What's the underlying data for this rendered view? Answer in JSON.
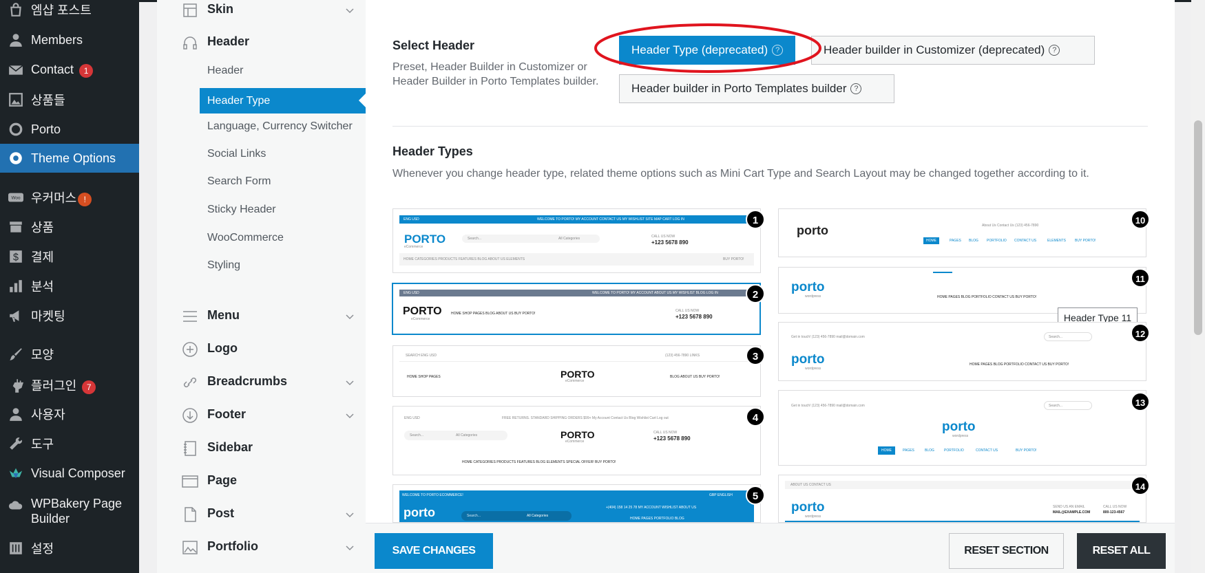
{
  "wp_menu": {
    "items": [
      {
        "label": "엠샵 포스트",
        "icon": "bag-icon",
        "badge": ""
      },
      {
        "label": "Members",
        "icon": "user-icon",
        "badge": ""
      },
      {
        "label": "Contact",
        "icon": "mail-icon",
        "badge": "1"
      },
      {
        "label": "상품들",
        "icon": "image-icon",
        "badge": ""
      },
      {
        "label": "Porto",
        "icon": "circle-icon",
        "badge": ""
      },
      {
        "label": "Theme Options",
        "icon": "gear-icon",
        "badge": ""
      },
      {
        "label": "우커머스",
        "icon": "woo-icon",
        "badge": "!"
      },
      {
        "label": "상품",
        "icon": "archive-icon",
        "badge": ""
      },
      {
        "label": "결제",
        "icon": "dollar-icon",
        "badge": ""
      },
      {
        "label": "분석",
        "icon": "bar-chart-icon",
        "badge": ""
      },
      {
        "label": "마켓팅",
        "icon": "megaphone-icon",
        "badge": ""
      },
      {
        "label": "모양",
        "icon": "brush-icon",
        "badge": ""
      },
      {
        "label": "플러그인",
        "icon": "plugin-icon",
        "badge": "7"
      },
      {
        "label": "사용자",
        "icon": "user-icon",
        "badge": ""
      },
      {
        "label": "도구",
        "icon": "wrench-icon",
        "badge": ""
      },
      {
        "label": "Visual Composer",
        "icon": "vc-icon",
        "badge": ""
      },
      {
        "label": "WPBakery Page Builder",
        "icon": "cloud-icon",
        "badge": ""
      },
      {
        "label": "설정",
        "icon": "sliders-icon",
        "badge": ""
      }
    ]
  },
  "options_nav": {
    "skin": "Skin",
    "header": "Header",
    "header_subs": [
      "Header",
      "Header Type",
      "Language, Currency Switcher",
      "Social Links",
      "Search Form",
      "Sticky Header",
      "WooCommerce",
      "Styling"
    ],
    "menu": "Menu",
    "logo": "Logo",
    "breadcrumbs": "Breadcrumbs",
    "footer": "Footer",
    "sidebar": "Sidebar",
    "page": "Page",
    "post": "Post",
    "portfolio": "Portfolio"
  },
  "select_header": {
    "title": "Select Header",
    "desc": "Preset, Header Builder in Customizer or Header Builder in Porto Templates builder.",
    "options": [
      "Header Type (deprecated)",
      "Header builder in Customizer (deprecated)",
      "Header builder in Porto Templates builder"
    ],
    "help_glyph": "?"
  },
  "header_types": {
    "title": "Header Types",
    "desc": "Whenever you change header type, related theme options such as Mini Cart Type and Search Layout may be changed together according to it.",
    "numbers": [
      "1",
      "2",
      "3",
      "4",
      "5",
      "10",
      "11",
      "12",
      "13",
      "14"
    ],
    "tooltip": "Header Type 11",
    "previews": {
      "t1": {
        "logo": "PORTO",
        "logo_sub": "eCommerce",
        "phone_label": "CALL US NOW",
        "phone": "+123 5678 890",
        "search": "Search...",
        "categories": "All Categories",
        "topbar": "WELCOME TO PORTO!   MY ACCOUNT   CONTACT US   MY WISHLIST   SITE MAP   CART   LOG IN",
        "lang": "ENG   USD",
        "nav": "HOME   CATEGORIES   PRODUCTS   FEATURES   BLOG   ABOUT US   ELEMENTS",
        "buy": "BUY PORTO!"
      },
      "t2": {
        "logo": "PORTO",
        "logo_sub": "eCommerce",
        "nav": "HOME   SHOP   PAGES   BLOG   ABOUT US   BUY PORTO!",
        "phone_label": "CALL US NOW",
        "phone": "+123 5678 890",
        "topbar": "WELCOME TO PORTO!   MY ACCOUNT   ABOUT US   MY WISHLIST   BLOG   LOG IN",
        "lang": "ENG   USD"
      },
      "t3": {
        "logo": "PORTO",
        "logo_sub": "eCommerce",
        "top_left": "SEARCH   ENG   USD",
        "top_right": "(123) 456-7890   LINKS",
        "nav_left": "HOME   SHOP   PAGES",
        "nav_right": "BLOG   ABOUT US   BUY PORTO!"
      },
      "t4": {
        "logo": "PORTO",
        "logo_sub": "eCommerce",
        "topbar": "FREE RETURNS. STANDARD SHIPPING ORDERS $99+   My Account   Contact Us   Blog   Wishlist   Cart   Log out",
        "lang": "ENG   USD",
        "search": "Search...",
        "categories": "All Categories",
        "phone_label": "CALL US NOW",
        "phone": "+123 5678 890",
        "nav": "HOME   CATEGORIES   PRODUCTS   FEATURES   BLOG   ELEMENTS   SPECIAL OFFER!   BUY PORTO!"
      },
      "t5": {
        "logo": "porto",
        "topbar": "WELCOME TO PORTO ECOMMERCE!",
        "top_right": "GBP   ENGLISH",
        "search": "Search...",
        "categories": "All Categories",
        "phone": "+(404) 158 14 25 78   MY ACCOUNT   WISHLIST   ABOUT US",
        "nav": "HOME   PAGES   PORTFOLIO   BLOG"
      },
      "t10": {
        "logo": "porto",
        "logo_sub": "wordpress",
        "top": "About Us   Contact Us   (123) 456-7890",
        "nav": [
          "HOME",
          "PAGES",
          "BLOG",
          "PORTFOLIO",
          "CONTACT US",
          "ELEMENTS",
          "BUY PORTO!"
        ]
      },
      "t11": {
        "logo": "porto",
        "logo_sub": "wordpress",
        "nav": "HOME   PAGES   BLOG   PORTFOLIO   CONTACT US   BUY PORTO!"
      },
      "t12": {
        "logo": "porto",
        "logo_sub": "wordpress",
        "top": "Get in touch!   (123) 456-7890   mail@domain.com",
        "search": "Search...",
        "nav": "HOME   PAGES   BLOG   PORTFOLIO   CONTACT US   BUY PORTO!"
      },
      "t13": {
        "logo": "porto",
        "logo_sub": "wordpress",
        "top": "Get in touch!   (123) 456-7890   mail@domain.com",
        "search": "Search...",
        "nav": [
          "HOME",
          "PAGES",
          "BLOG",
          "PORTFOLIO",
          "CONTACT US",
          "BUY PORTO!"
        ]
      },
      "t14": {
        "logo": "porto",
        "logo_sub": "wordpress",
        "top": "ABOUT US   CONTACT US",
        "email_label": "SEND US AN EMAIL",
        "email": "MAIL@EXAMPLE.COM",
        "call_label": "CALL US NOW",
        "call": "800-123-4567"
      }
    }
  },
  "footer": {
    "save": "SAVE CHANGES",
    "reset_section": "RESET SECTION",
    "reset_all": "RESET ALL"
  },
  "colors": {
    "accent": "#0b88cc",
    "wp_active": "#2271b1",
    "wp_bg": "#1d2327",
    "annotation_red": "#e0141e"
  }
}
